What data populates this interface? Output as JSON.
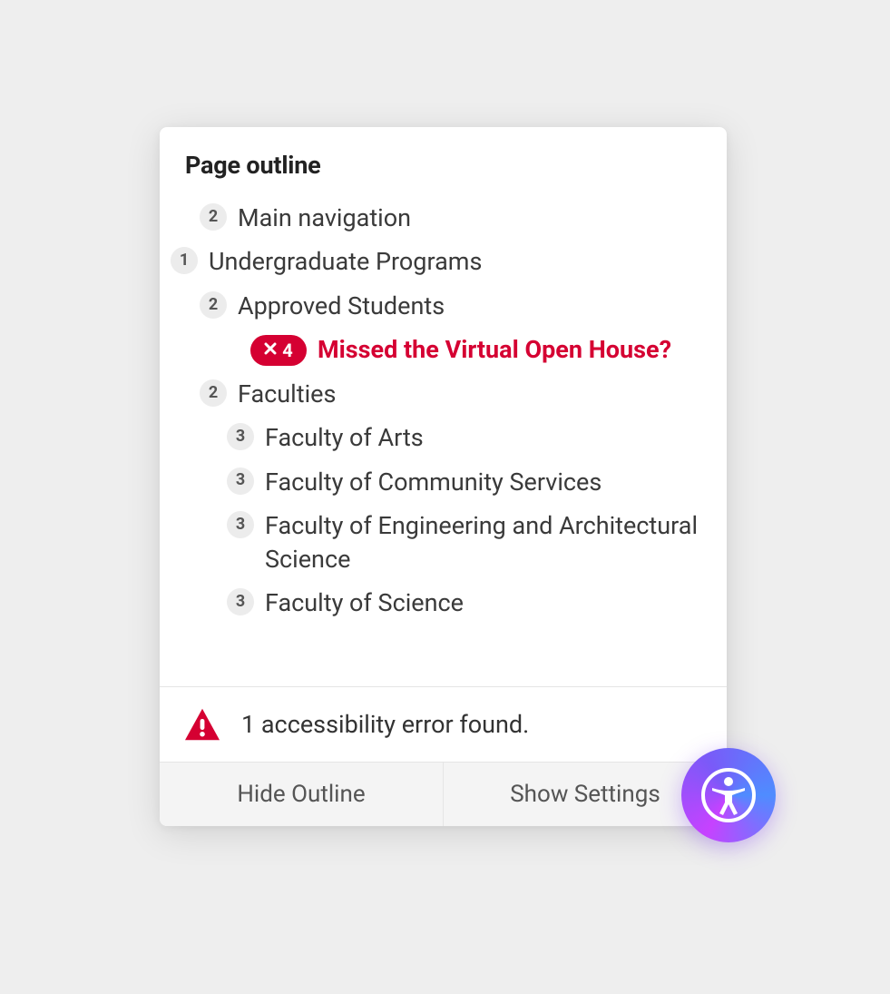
{
  "panel": {
    "title": "Page outline"
  },
  "outline": [
    {
      "level": 2,
      "label": "Main navigation",
      "error": false
    },
    {
      "level": 1,
      "label": "Undergraduate Programs",
      "error": false
    },
    {
      "level": 2,
      "label": "Approved Students",
      "error": false
    },
    {
      "level": 4,
      "label": "Missed the Virtual Open House?",
      "error": true
    },
    {
      "level": 2,
      "label": "Faculties",
      "error": false
    },
    {
      "level": 3,
      "label": "Faculty of Arts",
      "error": false
    },
    {
      "level": 3,
      "label": "Faculty of Community Services",
      "error": false
    },
    {
      "level": 3,
      "label": "Faculty of Engineering and Architectural Science",
      "error": false
    },
    {
      "level": 3,
      "label": "Faculty of Science",
      "error": false
    }
  ],
  "status": {
    "message": "1 accessibility error found."
  },
  "buttons": {
    "hide_outline": "Hide Outline",
    "show_settings": "Show Settings"
  },
  "colors": {
    "error": "#d50032",
    "badge_bg": "#ececec",
    "panel_bg": "#ffffff",
    "page_bg": "#eeeeee"
  },
  "icons": {
    "alert": "alert-triangle-icon",
    "close": "close-x-icon",
    "accessibility": "accessibility-person-icon"
  }
}
